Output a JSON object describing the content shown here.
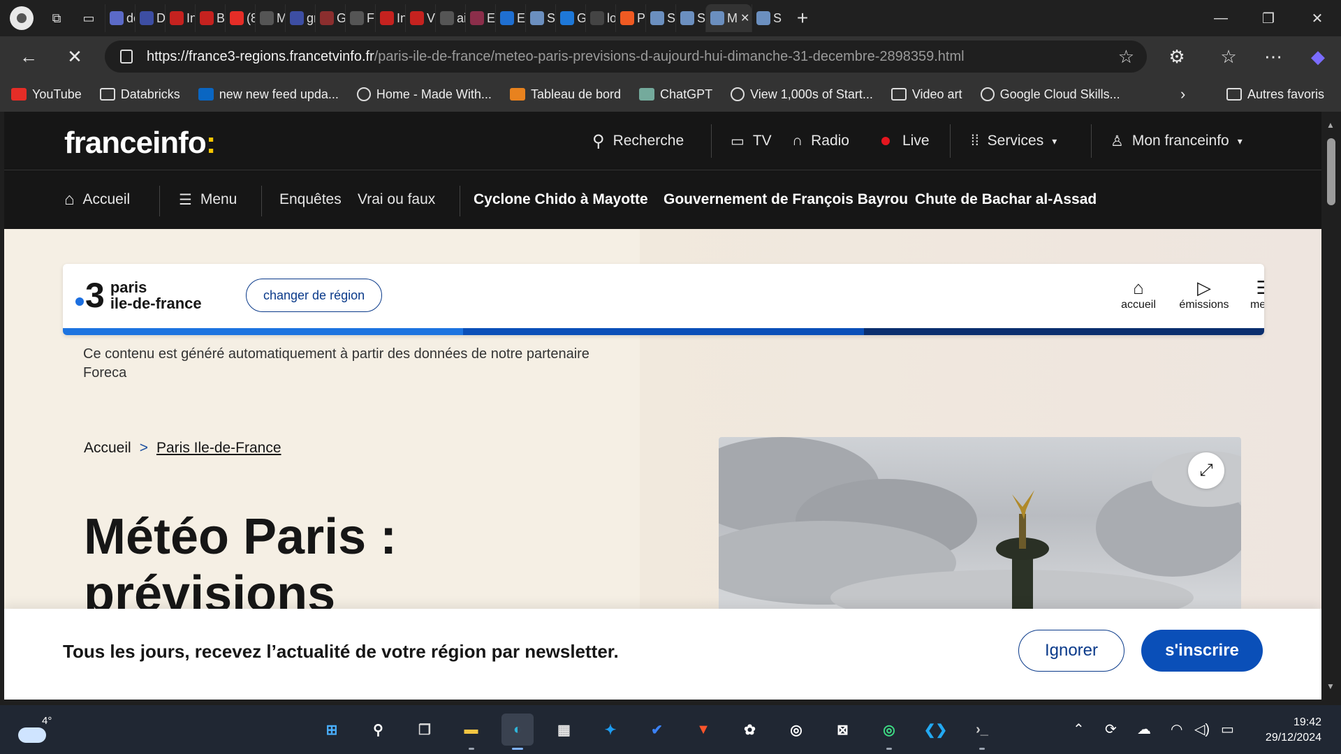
{
  "browser": {
    "tabs": [
      {
        "icon": "chrome-icon",
        "color": "#5b6ac7",
        "label": "de"
      },
      {
        "icon": "app-icon",
        "color": "#3d4ea3",
        "label": "D"
      },
      {
        "icon": "gmail-icon",
        "color": "#c5221f",
        "label": "In"
      },
      {
        "icon": "gmail-icon",
        "color": "#c5221f",
        "label": "Bo"
      },
      {
        "icon": "youtube-icon",
        "color": "#e52d27",
        "label": "(8"
      },
      {
        "icon": "github-icon",
        "color": "#555555",
        "label": "M"
      },
      {
        "icon": "search-icon",
        "color": "#3d4ea3",
        "label": "gr"
      },
      {
        "icon": "number-icon",
        "color": "#8b2e2e",
        "label": "G"
      },
      {
        "icon": "github-icon",
        "color": "#555555",
        "label": "Fi"
      },
      {
        "icon": "gmail-icon",
        "color": "#c5221f",
        "label": "In"
      },
      {
        "icon": "gmail-icon",
        "color": "#c5221f",
        "label": "V"
      },
      {
        "icon": "github-icon",
        "color": "#555555",
        "label": "ai"
      },
      {
        "icon": "mail-icon",
        "color": "#8b2e4a",
        "label": "Ec"
      },
      {
        "icon": "k-icon",
        "color": "#1f6fd1",
        "label": "Ex"
      },
      {
        "icon": "notepad-icon",
        "color": "#6b8fbf",
        "label": "Sc"
      },
      {
        "icon": "butterfly-icon",
        "color": "#1e78d8",
        "label": "G"
      },
      {
        "icon": "app-icon",
        "color": "#444444",
        "label": "lo"
      },
      {
        "icon": "sun-icon",
        "color": "#f05a22",
        "label": "Pa"
      },
      {
        "icon": "notepad-icon",
        "color": "#6b8fbf",
        "label": "Sc"
      },
      {
        "icon": "notepad-icon",
        "color": "#6b8fbf",
        "label": "Sc"
      }
    ],
    "active_tab": {
      "label": "M"
    },
    "last_tab": {
      "label": "Sc"
    },
    "url_host": "https://france3-regions.francetvinfo.fr",
    "url_path": "/paris-ile-de-france/meteo-paris-previsions-d-aujourd-hui-dimanche-31-decembre-2898359.html",
    "bookmarks": [
      {
        "label": "YouTube",
        "icon": "youtube-icon",
        "color": "#e52d27",
        "kind": "icon"
      },
      {
        "label": "Databricks",
        "icon": "folder-icon",
        "kind": "folder"
      },
      {
        "label": "new new feed upda...",
        "icon": "linkedin-icon",
        "color": "#0a66c2",
        "kind": "icon"
      },
      {
        "label": "Home - Made With...",
        "icon": "globe-icon",
        "kind": "globe"
      },
      {
        "label": "Tableau de bord",
        "icon": "fox-icon",
        "color": "#e8821e",
        "kind": "icon"
      },
      {
        "label": "ChatGPT",
        "icon": "chatgpt-icon",
        "color": "#74aa9c",
        "kind": "icon"
      },
      {
        "label": "View 1,000s of Start...",
        "icon": "globe-icon",
        "kind": "globe"
      },
      {
        "label": "Video art",
        "icon": "folder-icon",
        "kind": "folder"
      },
      {
        "label": "Google Cloud Skills...",
        "icon": "globe-icon",
        "kind": "globe"
      }
    ],
    "other_bookmarks": "Autres favoris"
  },
  "site": {
    "logo": "franceinfo",
    "logo_colon": ":",
    "nav": {
      "search": "Recherche",
      "tv": "TV",
      "radio": "Radio",
      "live": "Live",
      "services": "Services",
      "account": "Mon franceinfo"
    },
    "subnav": {
      "home": "Accueil",
      "menu": "Menu",
      "enquetes": "Enquêtes",
      "vrai_faux": "Vrai ou faux",
      "topic1": "Cyclone Chido à Mayotte",
      "topic2": "Gouvernement de François Bayrou",
      "topic3": "Chute de Bachar al-Assad"
    },
    "region": {
      "number": "3",
      "line1": "paris",
      "line2": "ile-de-france",
      "change": "changer de région",
      "home": "accueil",
      "emissions": "émissions",
      "menu": "menu"
    },
    "auto_note": "Ce contenu est généré automatiquement à partir des données de notre partenaire Foreca",
    "breadcrumb": {
      "home": "Accueil",
      "sep": ">",
      "current": "Paris Ile-de-France"
    },
    "title_line1": "Météo Paris :",
    "title_line2": "prévisions",
    "newsletter": {
      "text": "Tous les jours, recevez l’actualité de votre région par newsletter.",
      "ignore": "Ignorer",
      "subscribe": "s'inscrire"
    }
  },
  "taskbar": {
    "temperature": "4°",
    "time": "19:42",
    "date": "29/12/2024",
    "apps": [
      {
        "name": "start-icon",
        "color": "#4ab0ff"
      },
      {
        "name": "search-icon",
        "color": "#ffffff"
      },
      {
        "name": "task-view-icon",
        "color": "#d9d9d9"
      },
      {
        "name": "file-explorer-icon",
        "color": "#f4c542"
      },
      {
        "name": "edge-icon",
        "color": "#2fb5d9"
      },
      {
        "name": "store-icon",
        "color": "#e9e9e9"
      },
      {
        "name": "twitter-icon",
        "color": "#1d9bf0"
      },
      {
        "name": "todo-icon",
        "color": "#3b82f6"
      },
      {
        "name": "brave-icon",
        "color": "#fb542b"
      },
      {
        "name": "chatgpt-icon",
        "color": "#ffffff"
      },
      {
        "name": "app-icon",
        "color": "#ffffff"
      },
      {
        "name": "capcut-icon",
        "color": "#ffffff"
      },
      {
        "name": "app-icon",
        "color": "#3ddc84"
      },
      {
        "name": "vscode-icon",
        "color": "#23a9f2"
      },
      {
        "name": "terminal-icon",
        "color": "#cccccc"
      }
    ]
  }
}
